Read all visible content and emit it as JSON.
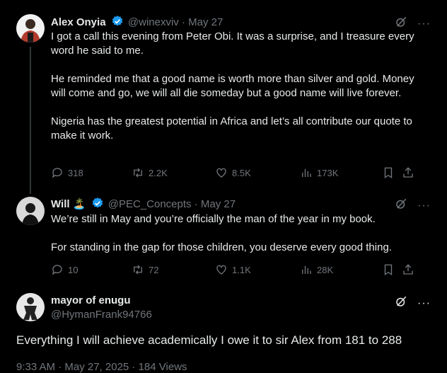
{
  "tweet1": {
    "name": "Alex Onyia",
    "handle": "@winexviv",
    "sep": "·",
    "date": "May 27",
    "paragraphs": [
      "I got a call this evening from Peter Obi. It was a surprise, and I treasure every word he said to me.",
      "He reminded me that a good name is worth more than silver and gold. Money will come and go, we will all die someday but a good name will live forever.",
      "Nigeria has the greatest potential in Africa and let’s all contribute our quote to make it work."
    ],
    "replies": "318",
    "reposts": "2.2K",
    "likes": "8.5K",
    "views": "173K"
  },
  "tweet2": {
    "name": "Will",
    "handle": "@PEC_Concepts",
    "sep": "·",
    "date": "May 27",
    "paragraphs": [
      "We’re still in May and you’re officially the man of the year in my book.",
      "For standing in the gap for those children, you deserve every good thing."
    ],
    "replies": "10",
    "reposts": "72",
    "likes": "1.1K",
    "views": "28K"
  },
  "tweet3": {
    "name": "mayor of enugu",
    "handle": "@HymanFrank94766",
    "text": "Everything I will achieve academically I owe it to sir Alex from 181 to 288",
    "timestamp_partial": "9:33 AM · May 27, 2025 · 184 Views"
  },
  "colors": {
    "background": "#000000",
    "text": "#e7e9ea",
    "muted": "#71767b",
    "verified": "#1d9bf0",
    "divider": "#2f3336"
  }
}
